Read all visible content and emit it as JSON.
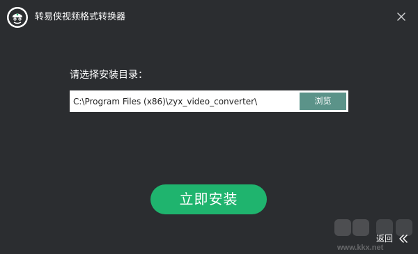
{
  "window": {
    "title": "转易侠视频格式转换器"
  },
  "header": {
    "logo_icon": "zhuanyixia-logo-icon",
    "close_icon": "close-icon"
  },
  "install": {
    "dir_label": "请选择安装目录：",
    "path_value": "C:\\Program Files (x86)\\zyx_video_converter\\",
    "browse_label": "浏览",
    "install_label": "立即安装"
  },
  "footer": {
    "back_label": "返回",
    "back_icon": "double-chevron-left-icon"
  },
  "watermark": {
    "url": "www.kkx.net"
  },
  "colors": {
    "background": "#2b2d30",
    "accent_green": "#1fb46e",
    "browse_button": "#5b9389",
    "text": "#ffffff"
  }
}
